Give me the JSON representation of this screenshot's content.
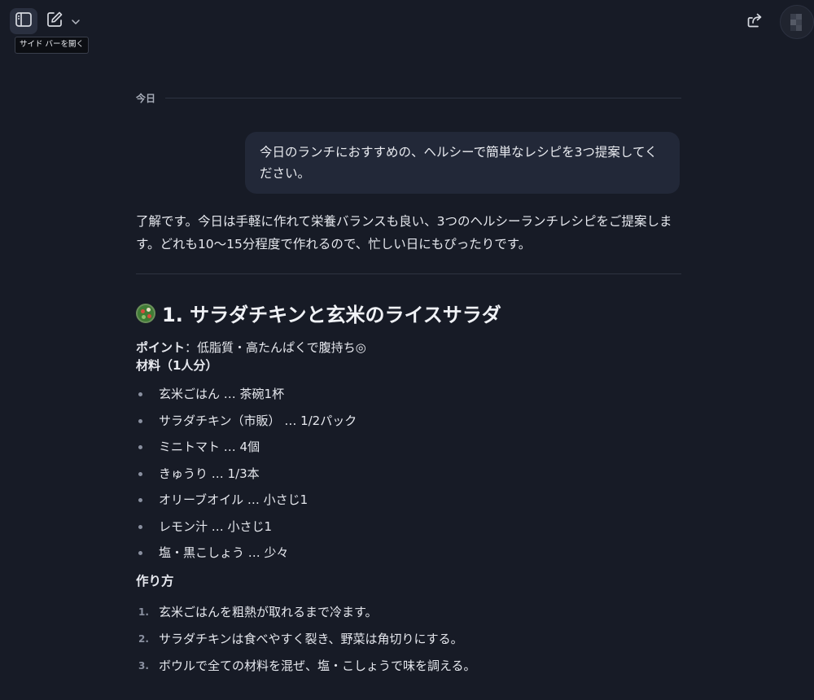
{
  "topbar": {
    "sidebar_button_icon": "sidebar-panel-icon",
    "compose_icon": "new-chat-icon",
    "chevron_icon": "chevron-down-icon",
    "share_icon": "share-icon",
    "tooltip": "サイド バーを開く"
  },
  "conversation": {
    "day_label": "今日",
    "user_message": "今日のランチにおすすめの、ヘルシーで簡単なレシピを3つ提案してください。",
    "assistant": {
      "intro": "了解です。今日は手軽に作れて栄養バランスも良い、3つのヘルシーランチレシピをご提案します。どれも10〜15分程度で作れるので、忙しい日にもぴったりです。",
      "recipe1": {
        "icon": "salad-icon",
        "title": "1. サラダチキンと玄米のライスサラダ",
        "point_label": "ポイント",
        "point_text": "：低脂質・高たんぱくで腹持ち◎",
        "ingredients_heading": "材料（1人分）",
        "ingredients": [
          "玄米ごはん … 茶碗1杯",
          "サラダチキン（市販） … 1/2パック",
          "ミニトマト … 4個",
          "きゅうり … 1/3本",
          "オリーブオイル … 小さじ1",
          "レモン汁 … 小さじ1",
          "塩・黒こしょう … 少々"
        ],
        "steps_heading": "作り方",
        "steps": [
          {
            "num": "1.",
            "text": "玄米ごはんを粗熱が取れるまで冷ます。"
          },
          {
            "num": "2.",
            "text": "サラダチキンは食べやすく裂き、野菜は角切りにする。"
          },
          {
            "num": "3.",
            "text": "ボウルで全ての材料を混ぜ、塩・こしょうで味を調える。"
          }
        ]
      }
    }
  },
  "colors": {
    "background": "#171b26",
    "user_bubble": "#222838",
    "text": "#e6e8ee"
  }
}
